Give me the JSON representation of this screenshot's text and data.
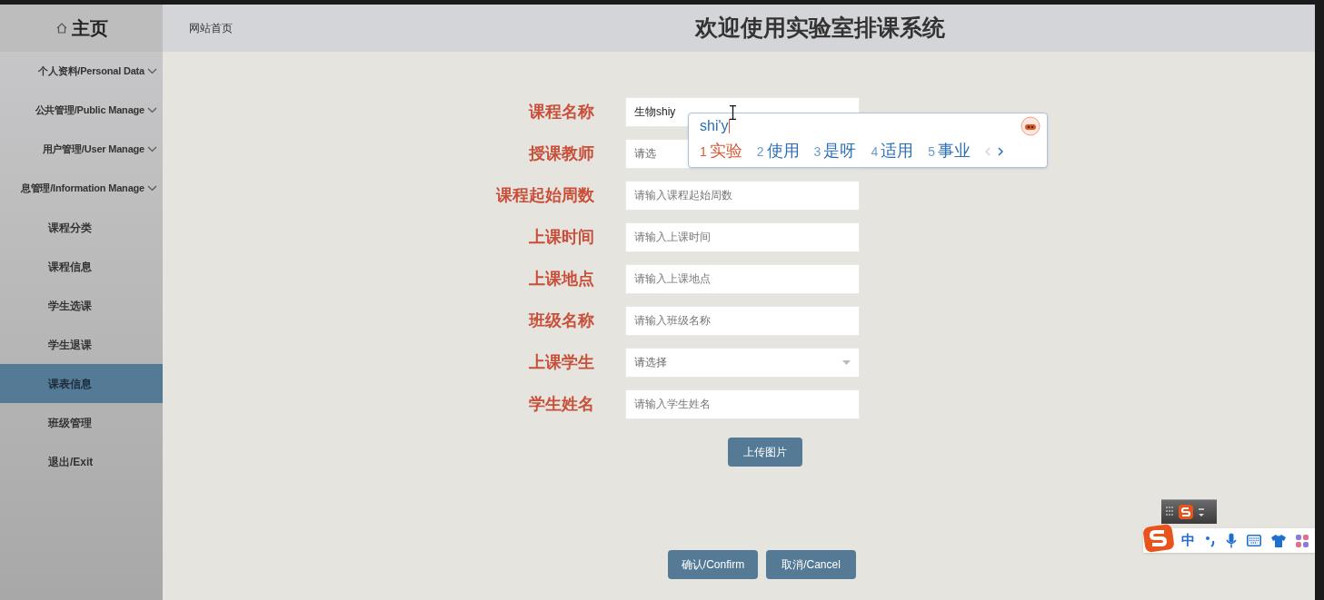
{
  "sidebar": {
    "title": "主页",
    "menu": [
      {
        "label": "个人资料/Personal Data",
        "kind": "group"
      },
      {
        "label": "公共管理/Public Manage",
        "kind": "group"
      },
      {
        "label": "用户管理/User Manage",
        "kind": "group"
      },
      {
        "label": "息管理/Information Manage",
        "kind": "group"
      },
      {
        "label": "课程分类",
        "kind": "link",
        "selected": false
      },
      {
        "label": "课程信息",
        "kind": "link",
        "selected": false
      },
      {
        "label": "学生选课",
        "kind": "link",
        "selected": false
      },
      {
        "label": "学生退课",
        "kind": "link",
        "selected": false
      },
      {
        "label": "课表信息",
        "kind": "link",
        "selected": true
      },
      {
        "label": "班级管理",
        "kind": "link",
        "selected": false
      },
      {
        "label": "退出/Exit",
        "kind": "link",
        "selected": false
      }
    ]
  },
  "header": {
    "breadcrumb": "网站首页",
    "title": "欢迎使用实验室排课系统"
  },
  "form": {
    "fields": [
      {
        "label": "课程名称",
        "kind": "input",
        "value": "生物shiy"
      },
      {
        "label": "授课教师",
        "kind": "select",
        "placeholder": "请选"
      },
      {
        "label": "课程起始周数",
        "kind": "input",
        "placeholder": "请输入课程起始周数"
      },
      {
        "label": "上课时间",
        "kind": "input",
        "placeholder": "请输入上课时间"
      },
      {
        "label": "上课地点",
        "kind": "input",
        "placeholder": "请输入上课地点"
      },
      {
        "label": "班级名称",
        "kind": "input",
        "placeholder": "请输入班级名称"
      },
      {
        "label": "上课学生",
        "kind": "select",
        "placeholder": "请选择"
      },
      {
        "label": "学生姓名",
        "kind": "input",
        "placeholder": "请输入学生姓名"
      }
    ],
    "upload_button": "上传图片",
    "buttons": [
      "确认/Confirm",
      "取消/Cancel"
    ]
  },
  "ime": {
    "composition": "shi'y",
    "candidates": [
      {
        "index": "1",
        "text": "实验",
        "selected": true
      },
      {
        "index": "2",
        "text": "使用",
        "selected": false
      },
      {
        "index": "3",
        "text": "是呀",
        "selected": false
      },
      {
        "index": "4",
        "text": "适用",
        "selected": false
      },
      {
        "index": "5",
        "text": "事业",
        "selected": false
      }
    ]
  },
  "ime_toolbar": {
    "mode": "中"
  }
}
